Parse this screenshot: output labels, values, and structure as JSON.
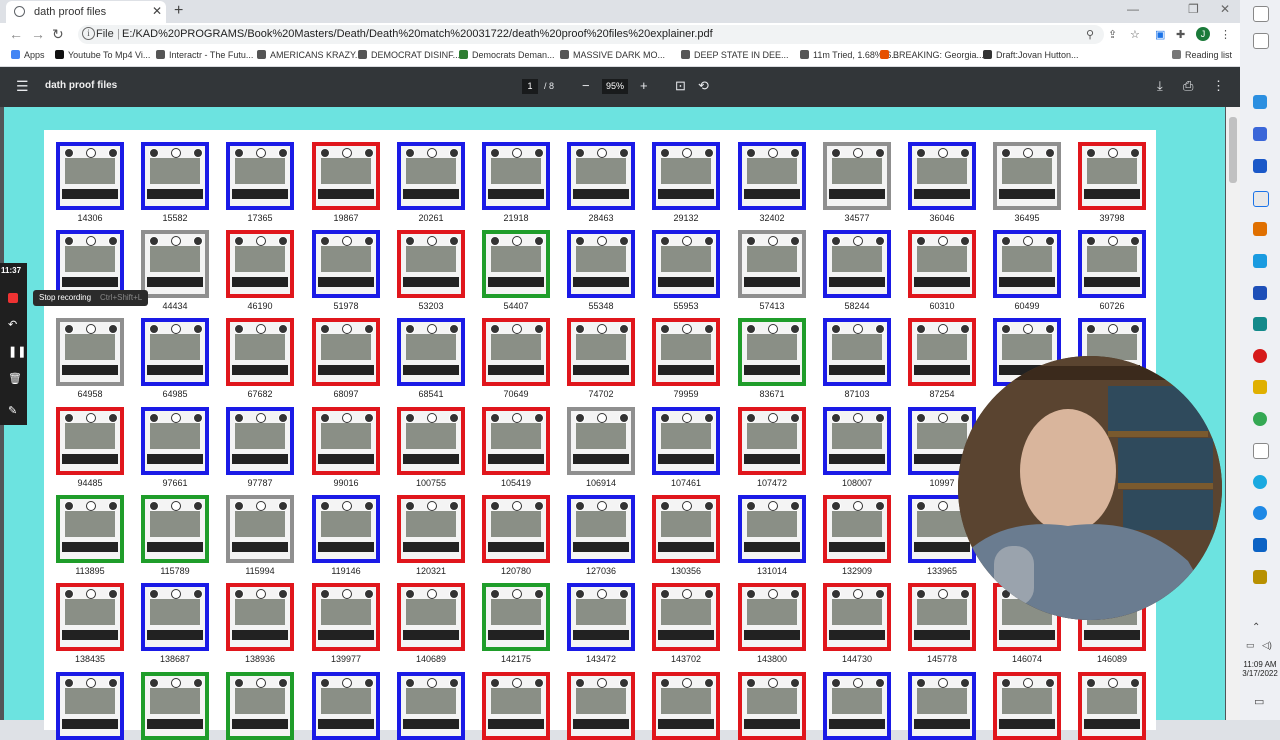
{
  "browser": {
    "tab_title": "dath proof files",
    "new_tab": "+",
    "omnibox_scheme": "File",
    "omnibox_url": "E:/KAD%20PROGRAMS/Book%20Masters/Death/Death%20match%20031722/death%20proof%20files%20explainer.pdf",
    "reading_list": "Reading list",
    "profile_initial": "J"
  },
  "bookmarks": [
    {
      "label": "Apps",
      "color": "#4285f4"
    },
    {
      "label": "Youtube To Mp4 Vi...",
      "color": "#111111"
    },
    {
      "label": "Interactr - The Futu...",
      "color": "#555555"
    },
    {
      "label": "AMERICANS KRAZY...",
      "color": "#555555"
    },
    {
      "label": "DEMOCRAT DISINF...",
      "color": "#555555"
    },
    {
      "label": "Democrats Deman...",
      "color": "#2e7d32"
    },
    {
      "label": "MASSIVE DARK MO...",
      "color": "#555555"
    },
    {
      "label": "DEEP STATE IN DEE...",
      "color": "#555555"
    },
    {
      "label": "11m Tried, 1.68% S...",
      "color": "#555555"
    },
    {
      "label": "BREAKING: Georgia...",
      "color": "#e65100"
    },
    {
      "label": "Draft:Jovan Hutton...",
      "color": "#333333"
    }
  ],
  "pdf_toolbar": {
    "doc_title": "dath proof files",
    "page_current": "1",
    "page_total": "/ 8",
    "zoom": "95%"
  },
  "recorder": {
    "time": "11:37",
    "tooltip_label": "Stop recording",
    "tooltip_shortcut": "Ctrl+Shift+L"
  },
  "clock": {
    "time": "11:09 AM",
    "date": "3/17/2022"
  },
  "colors": {
    "blue": "#1a1ae6",
    "red": "#e0161c",
    "gray": "#8f8f8f",
    "green": "#1f9d2a"
  },
  "thumbnails": [
    [
      {
        "id": "14306",
        "c": "blue"
      },
      {
        "id": "15582",
        "c": "blue"
      },
      {
        "id": "17365",
        "c": "blue"
      },
      {
        "id": "19867",
        "c": "red"
      },
      {
        "id": "20261",
        "c": "blue"
      },
      {
        "id": "21918",
        "c": "blue"
      },
      {
        "id": "28463",
        "c": "blue"
      },
      {
        "id": "29132",
        "c": "blue"
      },
      {
        "id": "32402",
        "c": "blue"
      },
      {
        "id": "34577",
        "c": "gray"
      },
      {
        "id": "36046",
        "c": "blue"
      },
      {
        "id": "36495",
        "c": "gray"
      },
      {
        "id": "39798",
        "c": "red"
      }
    ],
    [
      {
        "id": "",
        "c": "blue"
      },
      {
        "id": "44434",
        "c": "gray"
      },
      {
        "id": "46190",
        "c": "red"
      },
      {
        "id": "51978",
        "c": "blue"
      },
      {
        "id": "53203",
        "c": "red"
      },
      {
        "id": "54407",
        "c": "green"
      },
      {
        "id": "55348",
        "c": "blue"
      },
      {
        "id": "55953",
        "c": "blue"
      },
      {
        "id": "57413",
        "c": "gray"
      },
      {
        "id": "58244",
        "c": "blue"
      },
      {
        "id": "60310",
        "c": "red"
      },
      {
        "id": "60499",
        "c": "blue"
      },
      {
        "id": "60726",
        "c": "blue"
      }
    ],
    [
      {
        "id": "64958",
        "c": "gray"
      },
      {
        "id": "64985",
        "c": "blue"
      },
      {
        "id": "67682",
        "c": "red"
      },
      {
        "id": "68097",
        "c": "red"
      },
      {
        "id": "68541",
        "c": "blue"
      },
      {
        "id": "70649",
        "c": "red"
      },
      {
        "id": "74702",
        "c": "red"
      },
      {
        "id": "79959",
        "c": "red"
      },
      {
        "id": "83671",
        "c": "green"
      },
      {
        "id": "87103",
        "c": "blue"
      },
      {
        "id": "87254",
        "c": "red"
      },
      {
        "id": "",
        "c": "blue"
      },
      {
        "id": "",
        "c": "blue"
      }
    ],
    [
      {
        "id": "94485",
        "c": "red"
      },
      {
        "id": "97661",
        "c": "blue"
      },
      {
        "id": "97787",
        "c": "blue"
      },
      {
        "id": "99016",
        "c": "red"
      },
      {
        "id": "100755",
        "c": "red"
      },
      {
        "id": "105419",
        "c": "red"
      },
      {
        "id": "106914",
        "c": "gray"
      },
      {
        "id": "107461",
        "c": "blue"
      },
      {
        "id": "107472",
        "c": "red"
      },
      {
        "id": "108007",
        "c": "blue"
      },
      {
        "id": "10997",
        "c": "blue"
      }
    ],
    [
      {
        "id": "113895",
        "c": "green"
      },
      {
        "id": "115789",
        "c": "green"
      },
      {
        "id": "115994",
        "c": "gray"
      },
      {
        "id": "119146",
        "c": "blue"
      },
      {
        "id": "120321",
        "c": "red"
      },
      {
        "id": "120780",
        "c": "red"
      },
      {
        "id": "127036",
        "c": "blue"
      },
      {
        "id": "130356",
        "c": "red"
      },
      {
        "id": "131014",
        "c": "blue"
      },
      {
        "id": "132909",
        "c": "red"
      },
      {
        "id": "133965",
        "c": "blue"
      }
    ],
    [
      {
        "id": "138435",
        "c": "red"
      },
      {
        "id": "138687",
        "c": "blue"
      },
      {
        "id": "138936",
        "c": "red"
      },
      {
        "id": "139977",
        "c": "red"
      },
      {
        "id": "140689",
        "c": "red"
      },
      {
        "id": "142175",
        "c": "green"
      },
      {
        "id": "143472",
        "c": "blue"
      },
      {
        "id": "143702",
        "c": "red"
      },
      {
        "id": "143800",
        "c": "red"
      },
      {
        "id": "144730",
        "c": "red"
      },
      {
        "id": "145778",
        "c": "red"
      },
      {
        "id": "146074",
        "c": "red"
      },
      {
        "id": "146089",
        "c": "red"
      }
    ],
    [
      {
        "id": "",
        "c": "blue"
      },
      {
        "id": "",
        "c": "green"
      },
      {
        "id": "",
        "c": "green"
      },
      {
        "id": "",
        "c": "blue"
      },
      {
        "id": "",
        "c": "blue"
      },
      {
        "id": "",
        "c": "red"
      },
      {
        "id": "",
        "c": "red"
      },
      {
        "id": "",
        "c": "red"
      },
      {
        "id": "",
        "c": "red"
      },
      {
        "id": "",
        "c": "blue"
      },
      {
        "id": "",
        "c": "blue"
      },
      {
        "id": "",
        "c": "red"
      },
      {
        "id": "",
        "c": "red"
      }
    ]
  ]
}
